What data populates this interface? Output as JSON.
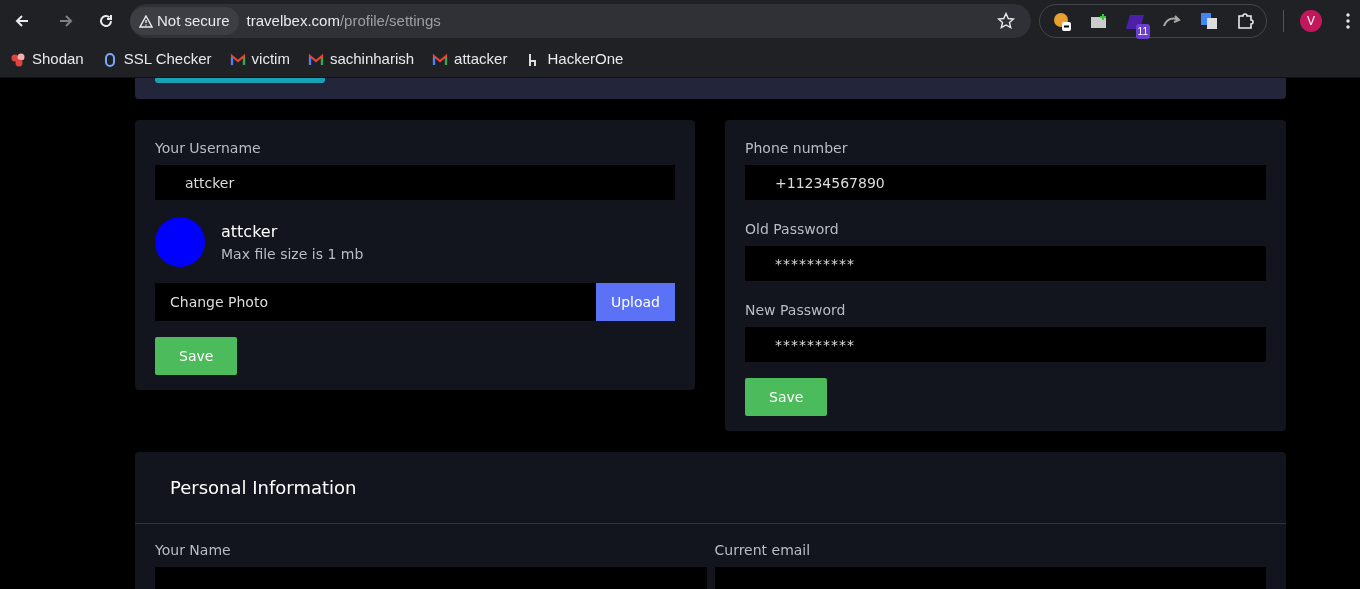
{
  "browser": {
    "security": "Not secure",
    "url_host": "travelbex.com",
    "url_path": "/profile/settings",
    "extension_badge": "11",
    "profile_initial": "V",
    "bookmarks": [
      {
        "label": "Shodan",
        "kind": "shodan"
      },
      {
        "label": "SSL Checker",
        "kind": "ssl"
      },
      {
        "label": "victim",
        "kind": "gmail"
      },
      {
        "label": "sachinharish",
        "kind": "gmail"
      },
      {
        "label": "attacker",
        "kind": "gmail"
      },
      {
        "label": "HackerOne",
        "kind": "h1"
      }
    ]
  },
  "profile_card": {
    "username_label": "Your Username",
    "username": "attcker",
    "display_name": "attcker",
    "file_hint": "Max file size is 1 mb",
    "photo_placeholder": "Change Photo",
    "upload": "Upload",
    "save": "Save"
  },
  "security_card": {
    "fields": [
      {
        "label": "Phone number",
        "value": "+11234567890",
        "kind": "text"
      },
      {
        "label": "Old Password",
        "value": "**********",
        "kind": "password"
      },
      {
        "label": "New Password",
        "value": "**********",
        "kind": "password"
      }
    ],
    "save": "Save"
  },
  "personal": {
    "title": "Personal Information",
    "fields": [
      {
        "label": "Your Name"
      },
      {
        "label": "Current email"
      }
    ]
  }
}
